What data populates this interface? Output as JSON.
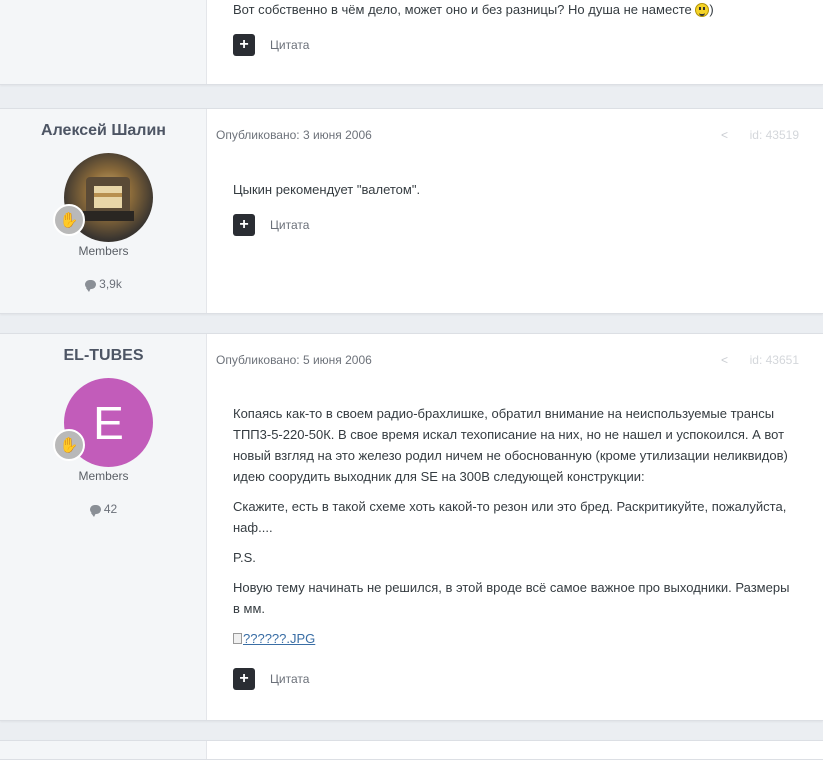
{
  "posts": [
    {
      "text": [
        "Вот собственно в чём дело, может оно и без разницы? Но душа не наместе",
        ")"
      ],
      "quote_label": "Цитата"
    },
    {
      "author": "Алексей Шалин",
      "group": "Members",
      "post_count": "3,9k",
      "published": "Опубликовано: 3 июня 2006",
      "id": "id: 43519",
      "paragraphs": [
        "Цыкин рекомендует \"валетом\"."
      ],
      "quote_label": "Цитата"
    },
    {
      "author": "EL-TUBES",
      "avatar_letter": "E",
      "avatar_color": "#c25cba",
      "group": "Members",
      "post_count": "42",
      "published": "Опубликовано: 5 июня 2006",
      "id": "id: 43651",
      "paragraphs": [
        "Копаясь как-то в своем радио-брахлишке, обратил внимание на неиспользуемые трансы ТПП3-5-220-50К. В свое время искал техописание на них, но не нашел и успокоился. А вот новый взгляд на это железо родил ничем не обоснованную (кроме утилизации неликвидов) идею соорудить выходник для SE на 300В следующей конструкции:",
        "Скажите, есть в такой схеме хоть какой-то резон или это бред. Раскритикуйте, пожалуйста, наф....",
        "P.S.",
        "Новую тему начинать не решился, в этой вроде всё самое важное про выходники. Размеры в мм."
      ],
      "image_alt": "??????.JPG",
      "quote_label": "Цитата"
    }
  ]
}
